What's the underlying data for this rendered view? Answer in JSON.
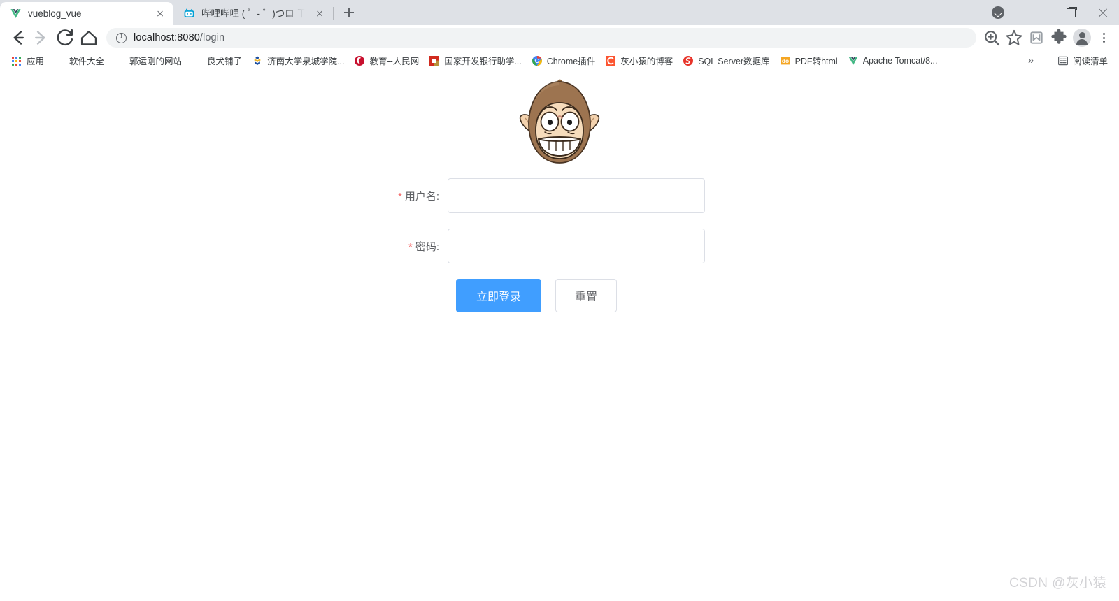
{
  "browser": {
    "tabs": [
      {
        "title": "vueblog_vue",
        "favicon": "vue-logo-icon",
        "active": true
      },
      {
        "title": "哔哩哔哩 ( ゜- ゜)つロ 干杯~-bili",
        "favicon": "bilibili-tv-icon",
        "active": false
      }
    ],
    "new_tab_label": "+",
    "window_controls": {
      "tab_search": "tab-search-icon",
      "minimize": "minimize-icon",
      "maximize": "maximize-icon",
      "close": "close-icon"
    },
    "toolbar": {
      "back": "back-arrow-icon",
      "forward": "forward-arrow-icon",
      "reload": "reload-icon",
      "home": "home-icon",
      "url_host": "localhost:8080",
      "url_path": "/login",
      "url_full": "localhost:8080/login",
      "site_info": "info-circle-icon",
      "zoom": "zoom-in-icon",
      "bookmark_star": "star-icon",
      "reading_list_toggle": "reading-list-icon",
      "extensions": "puzzle-piece-icon",
      "profile": "profile-avatar-icon",
      "menu": "three-dots-menu-icon"
    },
    "bookmarks": [
      {
        "label": "应用",
        "icon": "apps-grid-icon"
      },
      {
        "label": "软件大全",
        "icon": "globe-icon"
      },
      {
        "label": "郭运刚的网站",
        "icon": "globe-icon"
      },
      {
        "label": "良犬铺子",
        "icon": "globe-icon"
      },
      {
        "label": "济南大学泉城学院...",
        "icon": "university-icon"
      },
      {
        "label": "教育--人民网",
        "icon": "people-daily-icon"
      },
      {
        "label": "国家开发银行助学...",
        "icon": "cdb-bank-icon"
      },
      {
        "label": "Chrome插件",
        "icon": "chrome-icon"
      },
      {
        "label": "灰小猿的博客",
        "icon": "csdn-c-icon"
      },
      {
        "label": "SQL Server数据库",
        "icon": "sqlserver-icon"
      },
      {
        "label": "PDF转html",
        "icon": "do-pdf-icon"
      },
      {
        "label": "Apache Tomcat/8...",
        "icon": "tomcat-v-icon"
      }
    ],
    "bookmarks_overflow": "»",
    "reading_list_label": "阅读清单"
  },
  "page": {
    "logo_alt": "monkey-mascot-logo",
    "form": {
      "username": {
        "required_mark": "*",
        "label": "用户名:",
        "value": "",
        "placeholder": ""
      },
      "password": {
        "required_mark": "*",
        "label": "密码:",
        "value": "",
        "placeholder": ""
      },
      "submit_label": "立即登录",
      "reset_label": "重置"
    },
    "watermark": "CSDN @灰小猿"
  },
  "colors": {
    "primary": "#409eff",
    "required": "#f56c6c",
    "border": "#dcdfe6",
    "label_text": "#606266",
    "chrome_tabstrip": "#dee1e6",
    "watermark": "#d3d3d6"
  }
}
